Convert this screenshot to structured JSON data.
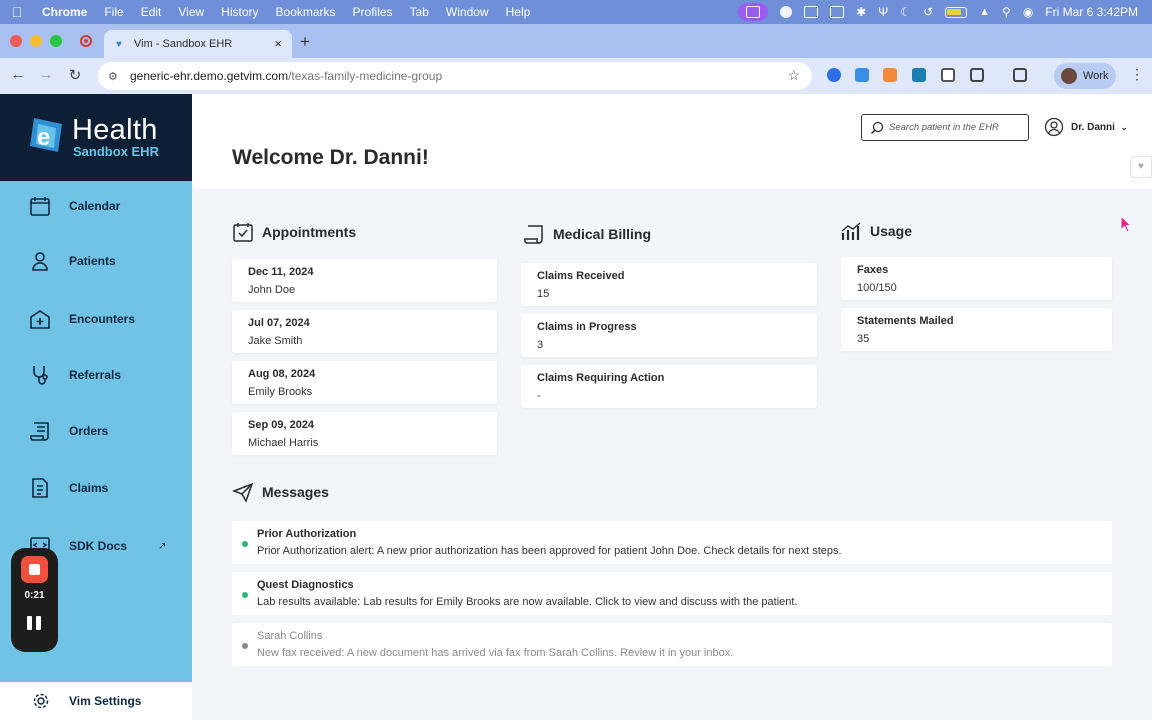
{
  "menubar": {
    "app": "Chrome",
    "items": [
      "File",
      "Edit",
      "View",
      "History",
      "Bookmarks",
      "Profiles",
      "Tab",
      "Window",
      "Help"
    ],
    "clock": "Fri Mar 6  3:42PM"
  },
  "browser": {
    "tab_title": "Vim - Sandbox EHR",
    "url_host": "generic-ehr.demo.getvim.com",
    "url_path": "/texas-family-medicine-group",
    "profile_label": "Work"
  },
  "brand": {
    "name": "Health",
    "subtitle": "Sandbox EHR",
    "accent": "#70c3e4",
    "dark": "#0d1f35"
  },
  "sidebar": {
    "items": [
      {
        "label": "Calendar",
        "icon": "calendar-icon"
      },
      {
        "label": "Patients",
        "icon": "patient-icon"
      },
      {
        "label": "Encounters",
        "icon": "encounter-icon"
      },
      {
        "label": "Referrals",
        "icon": "stethoscope-icon"
      },
      {
        "label": "Orders",
        "icon": "orders-icon"
      },
      {
        "label": "Claims",
        "icon": "claims-icon"
      },
      {
        "label": "SDK Docs",
        "icon": "sdk-icon",
        "external": "↗"
      }
    ],
    "settings_label": "Vim Settings"
  },
  "recorder": {
    "time": "0:21"
  },
  "header": {
    "welcome": "Welcome Dr. Danni!",
    "search_placeholder": "Search patient in the EHR",
    "user_name": "Dr. Danni"
  },
  "appointments": {
    "title": "Appointments",
    "items": [
      {
        "date": "Dec 11, 2024",
        "patient": "John Doe"
      },
      {
        "date": "Jul 07, 2024",
        "patient": "Jake Smith"
      },
      {
        "date": "Aug 08, 2024",
        "patient": "Emily Brooks"
      },
      {
        "date": "Sep 09, 2024",
        "patient": "Michael Harris"
      }
    ]
  },
  "billing": {
    "title": "Medical Billing",
    "items": [
      {
        "label": "Claims Received",
        "value": "15"
      },
      {
        "label": "Claims in Progress",
        "value": "3"
      },
      {
        "label": "Claims Requiring Action",
        "value": "-"
      }
    ]
  },
  "usage": {
    "title": "Usage",
    "items": [
      {
        "label": "Faxes",
        "value": "100/150"
      },
      {
        "label": "Statements Mailed",
        "value": "35"
      }
    ]
  },
  "messages": {
    "title": "Messages",
    "items": [
      {
        "title": "Prior Authorization",
        "body": "Prior Authorization alert: A new prior authorization has been approved for patient John Doe. Check details for next steps.",
        "status": "unread",
        "dot_color": "#2bb673"
      },
      {
        "title": "Quest Diagnostics",
        "body": "Lab results available: Lab results for Emily Brooks are now available. Click to view and discuss with the patient.",
        "status": "unread",
        "dot_color": "#2bb673"
      },
      {
        "title": "Sarah Collins",
        "body": "New fax received: A new document has arrived via fax from Sarah Collins. Review it in your inbox.",
        "status": "read",
        "dot_color": "#888888"
      }
    ]
  }
}
